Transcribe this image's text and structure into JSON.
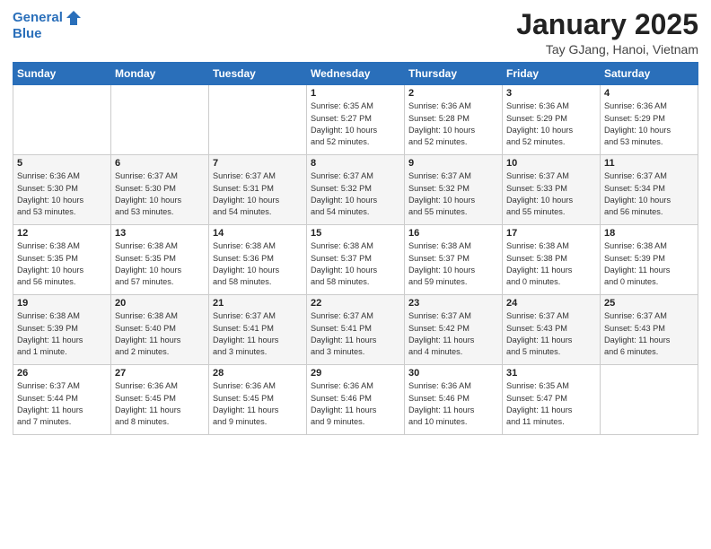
{
  "logo": {
    "line1": "General",
    "line2": "Blue"
  },
  "title": "January 2025",
  "subtitle": "Tay GJang, Hanoi, Vietnam",
  "days_of_week": [
    "Sunday",
    "Monday",
    "Tuesday",
    "Wednesday",
    "Thursday",
    "Friday",
    "Saturday"
  ],
  "weeks": [
    [
      {
        "day": "",
        "info": ""
      },
      {
        "day": "",
        "info": ""
      },
      {
        "day": "",
        "info": ""
      },
      {
        "day": "1",
        "info": "Sunrise: 6:35 AM\nSunset: 5:27 PM\nDaylight: 10 hours\nand 52 minutes."
      },
      {
        "day": "2",
        "info": "Sunrise: 6:36 AM\nSunset: 5:28 PM\nDaylight: 10 hours\nand 52 minutes."
      },
      {
        "day": "3",
        "info": "Sunrise: 6:36 AM\nSunset: 5:29 PM\nDaylight: 10 hours\nand 52 minutes."
      },
      {
        "day": "4",
        "info": "Sunrise: 6:36 AM\nSunset: 5:29 PM\nDaylight: 10 hours\nand 53 minutes."
      }
    ],
    [
      {
        "day": "5",
        "info": "Sunrise: 6:36 AM\nSunset: 5:30 PM\nDaylight: 10 hours\nand 53 minutes."
      },
      {
        "day": "6",
        "info": "Sunrise: 6:37 AM\nSunset: 5:30 PM\nDaylight: 10 hours\nand 53 minutes."
      },
      {
        "day": "7",
        "info": "Sunrise: 6:37 AM\nSunset: 5:31 PM\nDaylight: 10 hours\nand 54 minutes."
      },
      {
        "day": "8",
        "info": "Sunrise: 6:37 AM\nSunset: 5:32 PM\nDaylight: 10 hours\nand 54 minutes."
      },
      {
        "day": "9",
        "info": "Sunrise: 6:37 AM\nSunset: 5:32 PM\nDaylight: 10 hours\nand 55 minutes."
      },
      {
        "day": "10",
        "info": "Sunrise: 6:37 AM\nSunset: 5:33 PM\nDaylight: 10 hours\nand 55 minutes."
      },
      {
        "day": "11",
        "info": "Sunrise: 6:37 AM\nSunset: 5:34 PM\nDaylight: 10 hours\nand 56 minutes."
      }
    ],
    [
      {
        "day": "12",
        "info": "Sunrise: 6:38 AM\nSunset: 5:35 PM\nDaylight: 10 hours\nand 56 minutes."
      },
      {
        "day": "13",
        "info": "Sunrise: 6:38 AM\nSunset: 5:35 PM\nDaylight: 10 hours\nand 57 minutes."
      },
      {
        "day": "14",
        "info": "Sunrise: 6:38 AM\nSunset: 5:36 PM\nDaylight: 10 hours\nand 58 minutes."
      },
      {
        "day": "15",
        "info": "Sunrise: 6:38 AM\nSunset: 5:37 PM\nDaylight: 10 hours\nand 58 minutes."
      },
      {
        "day": "16",
        "info": "Sunrise: 6:38 AM\nSunset: 5:37 PM\nDaylight: 10 hours\nand 59 minutes."
      },
      {
        "day": "17",
        "info": "Sunrise: 6:38 AM\nSunset: 5:38 PM\nDaylight: 11 hours\nand 0 minutes."
      },
      {
        "day": "18",
        "info": "Sunrise: 6:38 AM\nSunset: 5:39 PM\nDaylight: 11 hours\nand 0 minutes."
      }
    ],
    [
      {
        "day": "19",
        "info": "Sunrise: 6:38 AM\nSunset: 5:39 PM\nDaylight: 11 hours\nand 1 minute."
      },
      {
        "day": "20",
        "info": "Sunrise: 6:38 AM\nSunset: 5:40 PM\nDaylight: 11 hours\nand 2 minutes."
      },
      {
        "day": "21",
        "info": "Sunrise: 6:37 AM\nSunset: 5:41 PM\nDaylight: 11 hours\nand 3 minutes."
      },
      {
        "day": "22",
        "info": "Sunrise: 6:37 AM\nSunset: 5:41 PM\nDaylight: 11 hours\nand 3 minutes."
      },
      {
        "day": "23",
        "info": "Sunrise: 6:37 AM\nSunset: 5:42 PM\nDaylight: 11 hours\nand 4 minutes."
      },
      {
        "day": "24",
        "info": "Sunrise: 6:37 AM\nSunset: 5:43 PM\nDaylight: 11 hours\nand 5 minutes."
      },
      {
        "day": "25",
        "info": "Sunrise: 6:37 AM\nSunset: 5:43 PM\nDaylight: 11 hours\nand 6 minutes."
      }
    ],
    [
      {
        "day": "26",
        "info": "Sunrise: 6:37 AM\nSunset: 5:44 PM\nDaylight: 11 hours\nand 7 minutes."
      },
      {
        "day": "27",
        "info": "Sunrise: 6:36 AM\nSunset: 5:45 PM\nDaylight: 11 hours\nand 8 minutes."
      },
      {
        "day": "28",
        "info": "Sunrise: 6:36 AM\nSunset: 5:45 PM\nDaylight: 11 hours\nand 9 minutes."
      },
      {
        "day": "29",
        "info": "Sunrise: 6:36 AM\nSunset: 5:46 PM\nDaylight: 11 hours\nand 9 minutes."
      },
      {
        "day": "30",
        "info": "Sunrise: 6:36 AM\nSunset: 5:46 PM\nDaylight: 11 hours\nand 10 minutes."
      },
      {
        "day": "31",
        "info": "Sunrise: 6:35 AM\nSunset: 5:47 PM\nDaylight: 11 hours\nand 11 minutes."
      },
      {
        "day": "",
        "info": ""
      }
    ]
  ]
}
